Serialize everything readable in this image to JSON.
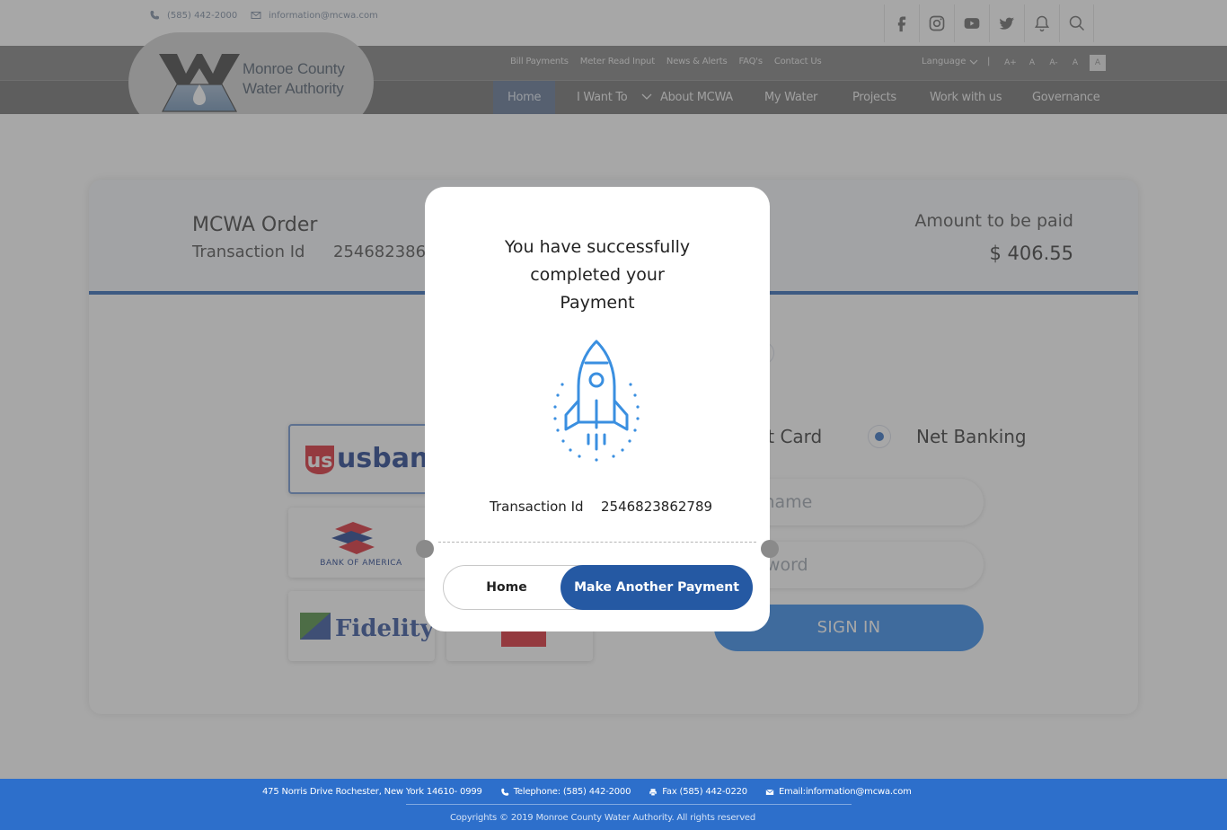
{
  "header": {
    "phone": "(585) 442-2000",
    "email": "information@mcwa.com",
    "social_icons": [
      "facebook-icon",
      "instagram-icon",
      "youtube-icon",
      "twitter-icon",
      "bell-icon",
      "search-icon"
    ]
  },
  "util_nav": {
    "links": [
      "Bill Payments",
      "Meter Read Input",
      "News & Alerts",
      "FAQ's",
      "Contact Us"
    ],
    "language_label": "Language",
    "separator": "|",
    "font_sizes": [
      "A+",
      "A",
      "A-",
      "A",
      "A"
    ]
  },
  "logo": {
    "line1": "Monroe County",
    "line2": "Water Authority"
  },
  "main_nav": {
    "items": [
      "Home",
      "I Want To",
      "About MCWA",
      "My Water",
      "Projects",
      "Work with us",
      "Governance"
    ]
  },
  "order": {
    "title": "MCWA Order",
    "tid_label": "Transaction Id",
    "tid_value": "254682386",
    "amount_label": "Amount to be paid",
    "amount_value": "$ 406.55"
  },
  "payment": {
    "types": [
      "bit Card",
      "Net Banking"
    ],
    "selected_type": "Net Banking",
    "banks": [
      "usbank",
      "BANK OF AMERICA",
      "Fidelity"
    ],
    "username_placeholder": "rname",
    "password_placeholder": "sword",
    "signin_label": "SIGN IN"
  },
  "modal": {
    "message": "You have successfully completed your Payment",
    "tid_label": "Transaction Id",
    "tid_value": "2546823862789",
    "home_label": "Home",
    "another_label": "Make Another Payment"
  },
  "footer": {
    "address": "475 Norris Drive Rochester, New York 14610- 0999",
    "telephone": "Telephone: (585) 442-2000",
    "fax": "Fax (585) 442-0220",
    "email": "Email:information@mcwa.com",
    "copyright": "Copyrights © 2019 Monroe County Water Authority. All rights reserved"
  },
  "colors": {
    "brand_blue": "#2d6fcb",
    "button_blue": "#2559a3",
    "signin_blue": "#2f86ea",
    "rocket_blue": "#3a8fe0"
  }
}
